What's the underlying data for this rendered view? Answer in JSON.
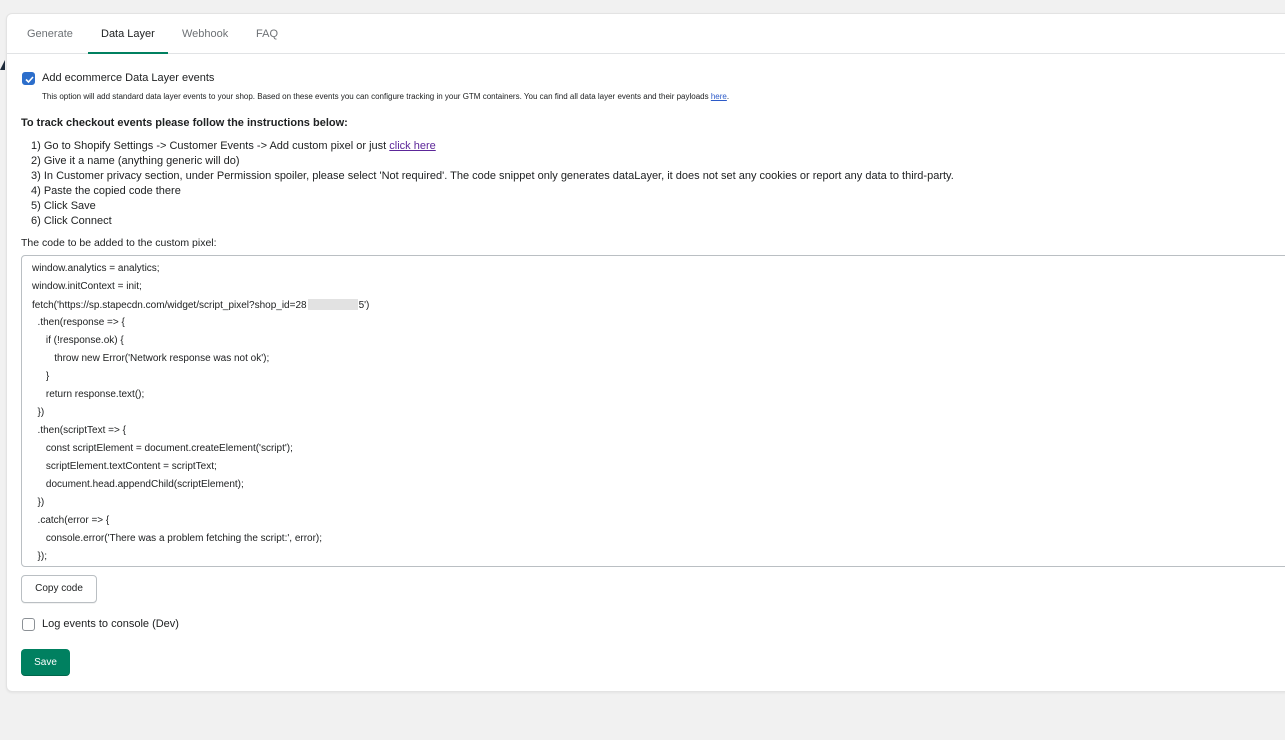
{
  "tabs": [
    {
      "label": "Generate"
    },
    {
      "label": "Data Layer"
    },
    {
      "label": "Webhook"
    },
    {
      "label": "FAQ"
    }
  ],
  "active_tab": "Data Layer",
  "ecommerce": {
    "label": "Add ecommerce Data Layer events",
    "checked": true,
    "help": "This option will add standard data layer events to your shop. Based on these events you can configure tracking in your GTM containers. You can find all data layer events and their payloads ",
    "help_link": "here",
    "help_end": "."
  },
  "instructions": {
    "heading": "To track checkout events please follow the instructions below:",
    "step1_prefix": "1) Go to Shopify Settings -> Customer Events -> Add custom pixel or just ",
    "step1_link": "click here",
    "steps": [
      "2) Give it a name (anything generic will do)",
      "3) In Customer privacy section, under Permission spoiler, please select 'Not required'. The code snippet only generates dataLayer, it does not set any cookies or report any data to third-party.",
      "4) Paste the copied code there",
      "5) Click Save",
      "6) Click Connect"
    ]
  },
  "code": {
    "label": "The code to be added to the custom pixel:",
    "fetch_prefix": "fetch('https://sp.stapecdn.com/widget/script_pixel?shop_id=28",
    "fetch_suffix": "5')",
    "lines": [
      "window.analytics = analytics;",
      "window.initContext = init;",
      "",
      "  .then(response => {",
      "     if (!response.ok) {",
      "        throw new Error('Network response was not ok');",
      "     }",
      "     return response.text();",
      "  })",
      "  .then(scriptText => {",
      "     const scriptElement = document.createElement('script');",
      "     scriptElement.textContent = scriptText;",
      "     document.head.appendChild(scriptElement);",
      "  })",
      "  .catch(error => {",
      "     console.error('There was a problem fetching the script:', error);",
      "  });"
    ],
    "copy_label": "Copy code"
  },
  "log_events": {
    "label": "Log events to console (Dev)",
    "checked": false
  },
  "save_label": "Save",
  "colors": {
    "accent": "#008060",
    "checkbox": "#2c6ecb",
    "link": "#2c5ac8",
    "background": "#f1f1f1"
  }
}
